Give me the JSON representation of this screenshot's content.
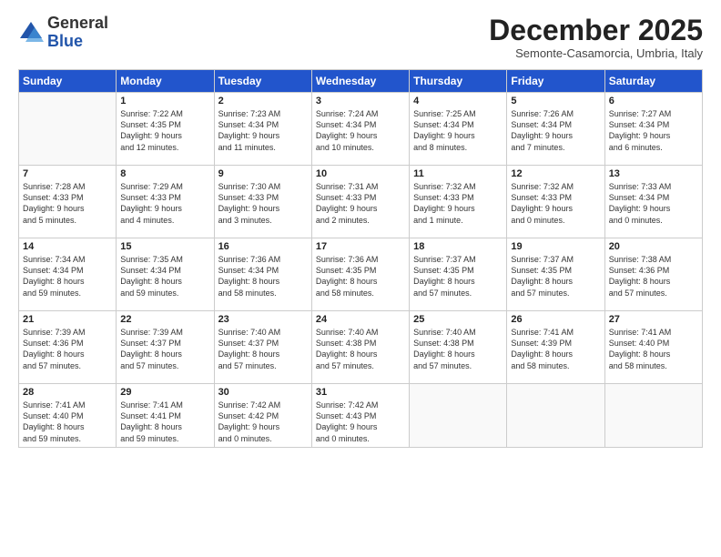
{
  "logo": {
    "general": "General",
    "blue": "Blue"
  },
  "header": {
    "month": "December 2025",
    "location": "Semonte-Casamorcia, Umbria, Italy"
  },
  "days": [
    "Sunday",
    "Monday",
    "Tuesday",
    "Wednesday",
    "Thursday",
    "Friday",
    "Saturday"
  ],
  "weeks": [
    [
      {
        "day": "",
        "content": ""
      },
      {
        "day": "1",
        "content": "Sunrise: 7:22 AM\nSunset: 4:35 PM\nDaylight: 9 hours\nand 12 minutes."
      },
      {
        "day": "2",
        "content": "Sunrise: 7:23 AM\nSunset: 4:34 PM\nDaylight: 9 hours\nand 11 minutes."
      },
      {
        "day": "3",
        "content": "Sunrise: 7:24 AM\nSunset: 4:34 PM\nDaylight: 9 hours\nand 10 minutes."
      },
      {
        "day": "4",
        "content": "Sunrise: 7:25 AM\nSunset: 4:34 PM\nDaylight: 9 hours\nand 8 minutes."
      },
      {
        "day": "5",
        "content": "Sunrise: 7:26 AM\nSunset: 4:34 PM\nDaylight: 9 hours\nand 7 minutes."
      },
      {
        "day": "6",
        "content": "Sunrise: 7:27 AM\nSunset: 4:34 PM\nDaylight: 9 hours\nand 6 minutes."
      }
    ],
    [
      {
        "day": "7",
        "content": "Sunrise: 7:28 AM\nSunset: 4:33 PM\nDaylight: 9 hours\nand 5 minutes."
      },
      {
        "day": "8",
        "content": "Sunrise: 7:29 AM\nSunset: 4:33 PM\nDaylight: 9 hours\nand 4 minutes."
      },
      {
        "day": "9",
        "content": "Sunrise: 7:30 AM\nSunset: 4:33 PM\nDaylight: 9 hours\nand 3 minutes."
      },
      {
        "day": "10",
        "content": "Sunrise: 7:31 AM\nSunset: 4:33 PM\nDaylight: 9 hours\nand 2 minutes."
      },
      {
        "day": "11",
        "content": "Sunrise: 7:32 AM\nSunset: 4:33 PM\nDaylight: 9 hours\nand 1 minute."
      },
      {
        "day": "12",
        "content": "Sunrise: 7:32 AM\nSunset: 4:33 PM\nDaylight: 9 hours\nand 0 minutes."
      },
      {
        "day": "13",
        "content": "Sunrise: 7:33 AM\nSunset: 4:34 PM\nDaylight: 9 hours\nand 0 minutes."
      }
    ],
    [
      {
        "day": "14",
        "content": "Sunrise: 7:34 AM\nSunset: 4:34 PM\nDaylight: 8 hours\nand 59 minutes."
      },
      {
        "day": "15",
        "content": "Sunrise: 7:35 AM\nSunset: 4:34 PM\nDaylight: 8 hours\nand 59 minutes."
      },
      {
        "day": "16",
        "content": "Sunrise: 7:36 AM\nSunset: 4:34 PM\nDaylight: 8 hours\nand 58 minutes."
      },
      {
        "day": "17",
        "content": "Sunrise: 7:36 AM\nSunset: 4:35 PM\nDaylight: 8 hours\nand 58 minutes."
      },
      {
        "day": "18",
        "content": "Sunrise: 7:37 AM\nSunset: 4:35 PM\nDaylight: 8 hours\nand 57 minutes."
      },
      {
        "day": "19",
        "content": "Sunrise: 7:37 AM\nSunset: 4:35 PM\nDaylight: 8 hours\nand 57 minutes."
      },
      {
        "day": "20",
        "content": "Sunrise: 7:38 AM\nSunset: 4:36 PM\nDaylight: 8 hours\nand 57 minutes."
      }
    ],
    [
      {
        "day": "21",
        "content": "Sunrise: 7:39 AM\nSunset: 4:36 PM\nDaylight: 8 hours\nand 57 minutes."
      },
      {
        "day": "22",
        "content": "Sunrise: 7:39 AM\nSunset: 4:37 PM\nDaylight: 8 hours\nand 57 minutes."
      },
      {
        "day": "23",
        "content": "Sunrise: 7:40 AM\nSunset: 4:37 PM\nDaylight: 8 hours\nand 57 minutes."
      },
      {
        "day": "24",
        "content": "Sunrise: 7:40 AM\nSunset: 4:38 PM\nDaylight: 8 hours\nand 57 minutes."
      },
      {
        "day": "25",
        "content": "Sunrise: 7:40 AM\nSunset: 4:38 PM\nDaylight: 8 hours\nand 57 minutes."
      },
      {
        "day": "26",
        "content": "Sunrise: 7:41 AM\nSunset: 4:39 PM\nDaylight: 8 hours\nand 58 minutes."
      },
      {
        "day": "27",
        "content": "Sunrise: 7:41 AM\nSunset: 4:40 PM\nDaylight: 8 hours\nand 58 minutes."
      }
    ],
    [
      {
        "day": "28",
        "content": "Sunrise: 7:41 AM\nSunset: 4:40 PM\nDaylight: 8 hours\nand 59 minutes."
      },
      {
        "day": "29",
        "content": "Sunrise: 7:41 AM\nSunset: 4:41 PM\nDaylight: 8 hours\nand 59 minutes."
      },
      {
        "day": "30",
        "content": "Sunrise: 7:42 AM\nSunset: 4:42 PM\nDaylight: 9 hours\nand 0 minutes."
      },
      {
        "day": "31",
        "content": "Sunrise: 7:42 AM\nSunset: 4:43 PM\nDaylight: 9 hours\nand 0 minutes."
      },
      {
        "day": "",
        "content": ""
      },
      {
        "day": "",
        "content": ""
      },
      {
        "day": "",
        "content": ""
      }
    ]
  ]
}
